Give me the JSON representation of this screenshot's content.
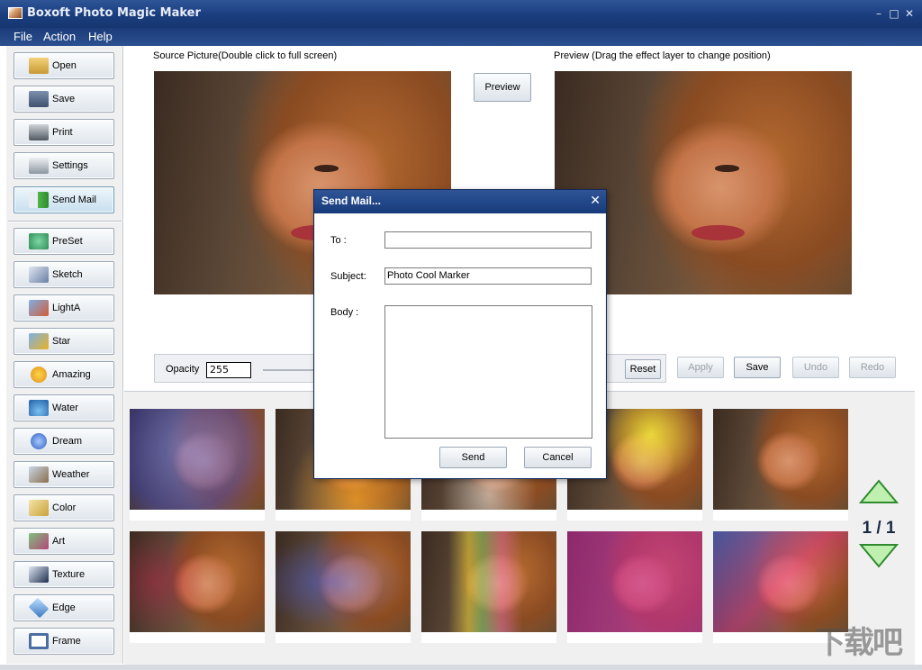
{
  "window": {
    "title": "Boxoft Photo Magic Maker"
  },
  "menu": [
    "File",
    "Action",
    "Help"
  ],
  "sidebar": {
    "file_buttons": [
      {
        "label": "Open",
        "icon": "folder-open-icon",
        "color": "#d9b04a"
      },
      {
        "label": "Save",
        "icon": "floppy-disk-icon",
        "color": "#5a6f8f"
      },
      {
        "label": "Print",
        "icon": "printer-icon",
        "color": "#5b6470"
      },
      {
        "label": "Settings",
        "icon": "settings-gear-icon",
        "color": "#9aa3ad"
      },
      {
        "label": "Send Mail",
        "icon": "send-mail-arrow-icon",
        "color": "#3a9b3a"
      }
    ],
    "effect_buttons": [
      {
        "label": "PreSet",
        "icon": "preset-icon",
        "color": "#2f8f5a"
      },
      {
        "label": "Sketch",
        "icon": "sketch-pencil-icon",
        "color": "#6a7fa6"
      },
      {
        "label": "LightA",
        "icon": "light-icon",
        "color": "#d35b35"
      },
      {
        "label": "Star",
        "icon": "star-icon",
        "color": "#e8b224"
      },
      {
        "label": "Amazing",
        "icon": "amazing-smiley-icon",
        "color": "#e8a020"
      },
      {
        "label": "Water",
        "icon": "water-drop-icon",
        "color": "#2a78c2"
      },
      {
        "label": "Dream",
        "icon": "dream-globe-icon",
        "color": "#3b6fd0"
      },
      {
        "label": "Weather",
        "icon": "weather-icon",
        "color": "#8a6f4a"
      },
      {
        "label": "Color",
        "icon": "color-palette-icon",
        "color": "#c9a23a"
      },
      {
        "label": "Art",
        "icon": "art-brush-icon",
        "color": "#b5467a"
      },
      {
        "label": "Texture",
        "icon": "texture-a-icon",
        "color": "#3a4f7a"
      },
      {
        "label": "Edge",
        "icon": "edge-diamond-icon",
        "color": "#4a88c8"
      },
      {
        "label": "Frame",
        "icon": "frame-icon",
        "color": "#4a6fa0"
      }
    ]
  },
  "source": {
    "caption": "Source Picture(Double click to full screen)"
  },
  "preview": {
    "caption": "Preview (Drag the effect layer to change position)",
    "button": "Preview"
  },
  "controls": {
    "opacity_label": "Opacity",
    "opacity_value": "255",
    "reset": "Reset",
    "apply": "Apply",
    "save": "Save",
    "undo": "Undo",
    "redo": "Redo"
  },
  "gallery": {
    "page": "1 / 1",
    "effects": [
      "bubbles-blue",
      "fire-sparks",
      "hearts-light",
      "yellow-halo",
      "plain",
      "red-stars",
      "blue-smoke",
      "rainbow-streaks",
      "pink-tint",
      "rainbow-sparkle"
    ]
  },
  "dialog": {
    "title": "Send Mail...",
    "to_label": "To :",
    "to_value": "",
    "subject_label": "Subject:",
    "subject_value": "Photo Cool Marker",
    "body_label": "Body :",
    "body_value": "",
    "send": "Send",
    "cancel": "Cancel"
  },
  "watermark": "下载吧"
}
